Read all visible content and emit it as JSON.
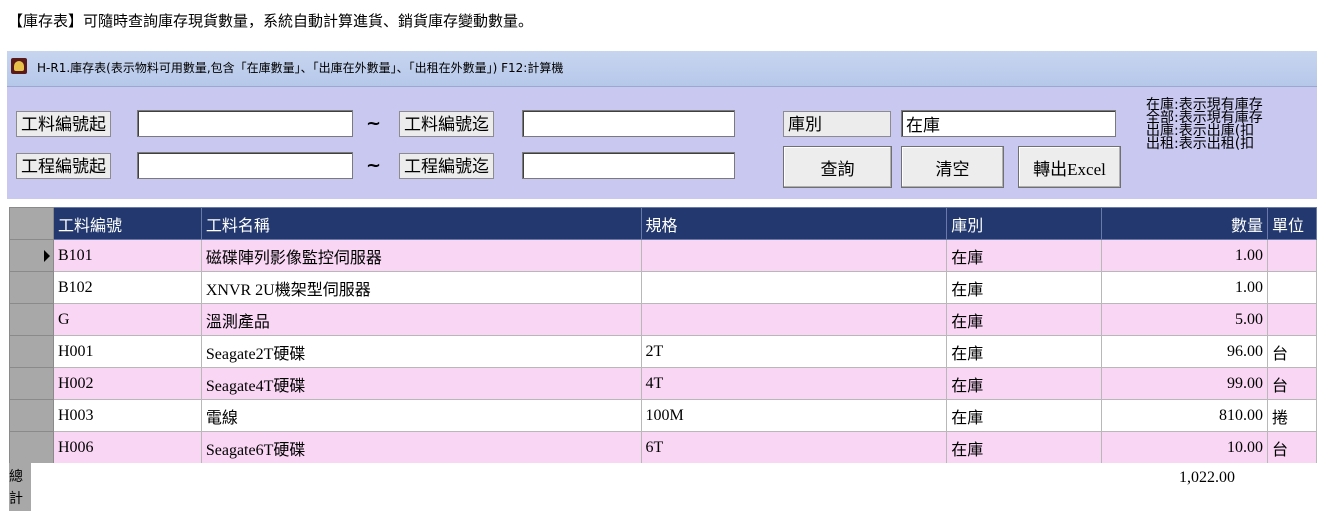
{
  "caption": "【庫存表】可隨時查詢庫存現貨數量，系統自動計算進貨、銷貨庫存變動數量。",
  "window": {
    "title": "H-R1.庫存表(表示物料可用數量,包含「在庫數量」、「出庫在外數量」、「出租在外數量」)  F12:計算機"
  },
  "filters": {
    "material_from_label": "工料編號起",
    "material_to_label": "工料編號迄",
    "project_from_label": "工程編號起",
    "project_to_label": "工程編號迄",
    "tilde": "~",
    "warehouse_label": "庫別",
    "warehouse_value": "在庫",
    "material_from_value": "",
    "material_to_value": "",
    "project_from_value": "",
    "project_to_value": ""
  },
  "buttons": {
    "query": "查詢",
    "clear": "清空",
    "export": "轉出Excel"
  },
  "notes": [
    "在庫:表示現有庫存",
    "全部:表示現有庫存",
    "出庫:表示出庫(扣",
    "出租:表示出租(扣"
  ],
  "table": {
    "columns": [
      "工料編號",
      "工料名稱",
      "規格",
      "庫別",
      "數量",
      "單位"
    ],
    "rows": [
      [
        "B101",
        "磁碟陣列影像監控伺服器",
        "",
        "在庫",
        "1.00",
        ""
      ],
      [
        "B102",
        "XNVR 2U機架型伺服器",
        "",
        "在庫",
        "1.00",
        ""
      ],
      [
        "G",
        "溫測產品",
        "",
        "在庫",
        "5.00",
        ""
      ],
      [
        "H001",
        "Seagate2T硬碟",
        "2T",
        "在庫",
        "96.00",
        "台"
      ],
      [
        "H002",
        "Seagate4T硬碟",
        "4T",
        "在庫",
        "99.00",
        "台"
      ],
      [
        "H003",
        "電線",
        "100M",
        "在庫",
        "810.00",
        "捲"
      ],
      [
        "H006",
        "Seagate6T硬碟",
        "6T",
        "在庫",
        "10.00",
        "台"
      ]
    ],
    "total_label": "總計",
    "total_value": "1,022.00"
  }
}
